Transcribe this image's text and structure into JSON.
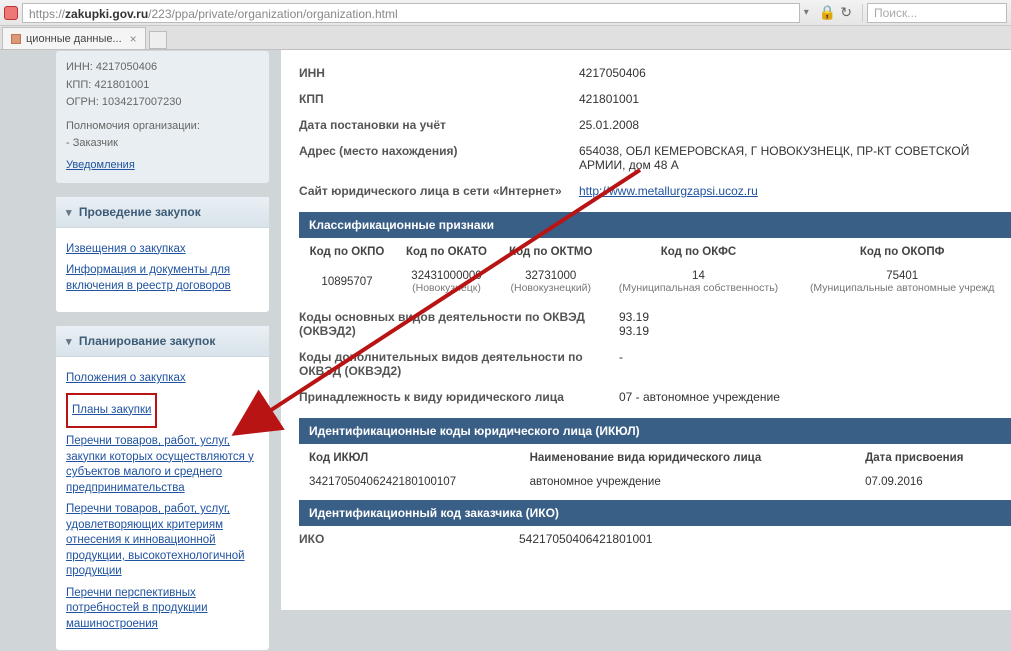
{
  "browser": {
    "url_scheme": "https://",
    "url_domain": "zakupki.gov.ru",
    "url_path": "/223/ppa/private/organization/organization.html",
    "search_placeholder": "Поиск...",
    "tab_title": "ционные данные..."
  },
  "org_summary": {
    "inn_label": "ИНН:",
    "inn_value": "4217050406",
    "kpp_label": "КПП:",
    "kpp_value": "421801001",
    "ogrn_label": "ОГРН:",
    "ogrn_value": "1034217007230",
    "powers_label": "Полномочия организации:",
    "powers_value": "- Заказчик",
    "notifications_link": "Уведомления"
  },
  "nav": {
    "block1_title": "Проведение закупок",
    "block1_items": [
      "Извещения о закупках",
      "Информация и документы для включения в реестр договоров"
    ],
    "block2_title": "Планирование закупок",
    "block2_items": [
      "Положения о закупках",
      "Планы закупки",
      "Перечни товаров, работ, услуг, закупки которых осуществляются у субъектов малого и среднего предпринимательства",
      "Перечни товаров, работ, услуг, удовлетворяющих критериям отнесения к инновационной продукции, высокотехнологичной продукции",
      "Перечни перспективных потребностей в продукции машиностроения"
    ]
  },
  "details": {
    "inn_label": "ИНН",
    "inn_value": "4217050406",
    "kpp_label": "КПП",
    "kpp_value": "421801001",
    "reg_date_label": "Дата постановки на учёт",
    "reg_date_value": "25.01.2008",
    "address_label": "Адрес (место нахождения)",
    "address_value": "654038, ОБЛ КЕМЕРОВСКАЯ, Г НОВОКУЗНЕЦК, ПР-КТ СОВЕТСКОЙ АРМИИ, дом 48 А",
    "site_label": "Сайт юридического лица в сети «Интернет»",
    "site_value": "http://www.metallurgzapsi.ucoz.ru"
  },
  "classification": {
    "section_title": "Классификационные признаки",
    "headers": {
      "okpo": "Код по ОКПО",
      "okato": "Код по ОКАТО",
      "oktmo": "Код по ОКТМО",
      "okfs": "Код по ОКФС",
      "okopf": "Код по ОКОПФ"
    },
    "values": {
      "okpo": "10895707",
      "okato": "32431000000",
      "okato_sub": "(Новокузнецк)",
      "oktmo": "32731000",
      "oktmo_sub": "(Новокузнецкий)",
      "okfs": "14",
      "okfs_sub": "(Муниципальная собственность)",
      "okopf": "75401",
      "okopf_sub": "(Муниципальные автономные учрежд"
    },
    "okved_main_label": "Коды основных видов деятельности по ОКВЭД (ОКВЭД2)",
    "okved_main_vals": "93.19\n93.19",
    "okved_extra_label": "Коды дополнительных видов деятельности по ОКВЭД (ОКВЭД2)",
    "okved_extra_vals": "-",
    "legal_kind_label": "Принадлежность к виду юридического лица",
    "legal_kind_value": "07 - автономное учреждение"
  },
  "ikul": {
    "section_title": "Идентификационные коды юридического лица (ИКЮЛ)",
    "col_code": "Код ИКЮЛ",
    "col_name": "Наименование вида юридического лица",
    "col_date": "Дата присвоения",
    "row_code": "34217050406242180100107",
    "row_name": "автономное учреждение",
    "row_date": "07.09.2016"
  },
  "iko": {
    "section_title": "Идентификационный код заказчика (ИКО)",
    "label": "ИКО",
    "value": "54217050406421801001"
  }
}
